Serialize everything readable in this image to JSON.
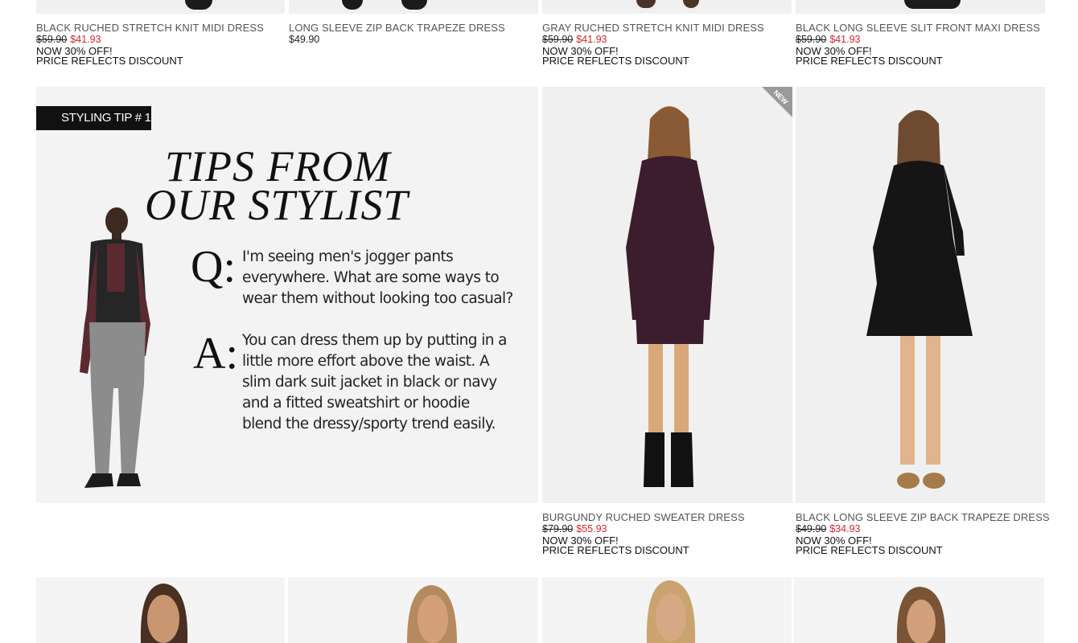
{
  "top_row": [
    {
      "name": "BLACK RUCHED STRETCH KNIT MIDI DRESS",
      "old_price": "$59.90",
      "new_price": "$41.93",
      "promo": "NOW 30% OFF!",
      "discount_note": "PRICE REFLECTS DISCOUNT"
    },
    {
      "name": "LONG SLEEVE ZIP BACK TRAPEZE DRESS",
      "price": "$49.90"
    },
    {
      "name": "GRAY RUCHED STRETCH KNIT MIDI DRESS",
      "old_price": "$59.90",
      "new_price": "$41.93",
      "promo": "NOW 30% OFF!",
      "discount_note": "PRICE REFLECTS DISCOUNT"
    },
    {
      "name": "BLACK LONG SLEEVE SLIT FRONT MAXI DRESS",
      "old_price": "$59.90",
      "new_price": "$41.93",
      "promo": "NOW 30% OFF!",
      "discount_note": "PRICE REFLECTS DISCOUNT"
    }
  ],
  "styling_tip": {
    "badge": "STYLING TIP # 1",
    "title_line1": "TIPS FROM",
    "title_line2": "OUR STYLIST",
    "q_letter": "Q:",
    "question": "I'm seeing men's jogger pants everywhere. What are some ways to wear them without looking too casual?",
    "a_letter": "A:",
    "answer": "You can dress them up by putting in a little more effort above the waist. A slim dark suit jacket in black or navy and a fitted sweatshirt or hoodie blend the dressy/sporty trend easily."
  },
  "middle_row": [
    {
      "name": "BURGUNDY RUCHED SWEATER DRESS",
      "old_price": "$79.90",
      "new_price": "$55.93",
      "promo": "NOW 30% OFF!",
      "discount_note": "PRICE REFLECTS DISCOUNT",
      "badge": "NEW",
      "dress_color": "#3b1d2e"
    },
    {
      "name": "BLACK LONG SLEEVE ZIP BACK TRAPEZE DRESS",
      "old_price": "$49.90",
      "new_price": "$34.93",
      "promo": "NOW 30% OFF!",
      "discount_note": "PRICE REFLECTS DISCOUNT",
      "dress_color": "#151515"
    }
  ],
  "colors": {
    "sale_price": "#d7262c",
    "badge_bg": "#111111",
    "tile_bg": "#f0f0f0"
  }
}
